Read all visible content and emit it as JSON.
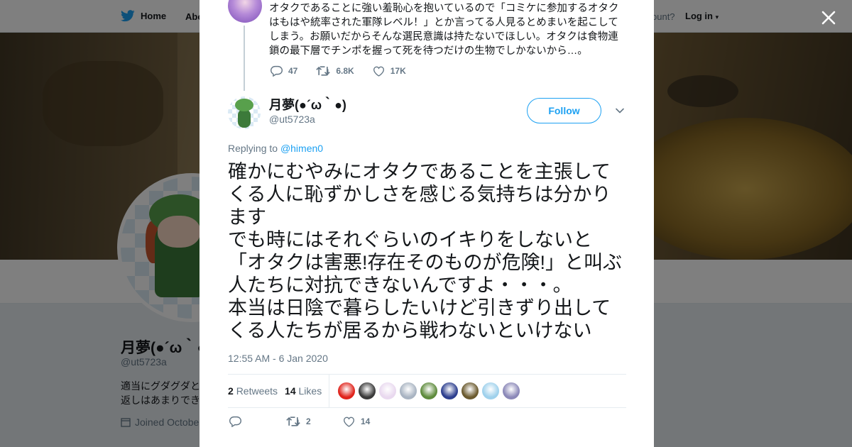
{
  "topnav": {
    "home_label": "Home",
    "about_label": "Abo",
    "account_prompt": "ccount?",
    "login_label": "Log in"
  },
  "profile": {
    "name": "月夢(●´ω｀●)",
    "handle": "@ut5723a",
    "bio_line1": "適当にグダグダと",
    "bio_line2": "返しはあまりでき",
    "joined": "Joined Octobe"
  },
  "parent_tweet": {
    "text": "オタクであることに強い羞恥心を抱いているので「コミケに参加するオタクはもはや統率された軍隊レベル！」とか言ってる人見るとめまいを起こしてしまう。お願いだからそんな選民意識は持たないでほしい。オタクは食物連鎖の最下層でチンポを握って死を待つだけの生物でしかないから…。",
    "replies": "47",
    "retweets": "6.8K",
    "likes": "17K"
  },
  "tweet": {
    "author_name": "月夢(●´ω｀●)",
    "author_handle": "@ut5723a",
    "follow_label": "Follow",
    "replying_prefix": "Replying to",
    "replying_to": "@himen0",
    "text": "確かにむやみにオタクであることを主張してくる人に恥ずかしさを感じる気持ちは分かります\nでも時にはそれぐらいのイキりをしないと「オタクは害悪!存在そのものが危険!」と叫ぶ人たちに対抗できないんですよ・・・。\n本当は日陰で暮らしたいけど引きずり出してくる人たちが居るから戦わないといけない",
    "timestamp": "12:55 AM - 6 Jan 2020",
    "retweet_count": "2",
    "retweet_label": "Retweets",
    "like_count": "14",
    "like_label": "Likes",
    "bottom_retweets": "2",
    "bottom_likes": "14"
  },
  "likers": [
    {
      "name": "liker-1",
      "color": "#e0241c"
    },
    {
      "name": "liker-2",
      "color": "#3a3a3a"
    },
    {
      "name": "liker-3",
      "color": "#e9d9ef"
    },
    {
      "name": "liker-4",
      "color": "#a9b4c2"
    },
    {
      "name": "liker-5",
      "color": "#5e8b3c"
    },
    {
      "name": "liker-6",
      "color": "#2d3f8f"
    },
    {
      "name": "liker-7",
      "color": "#6b5a2e"
    },
    {
      "name": "liker-8",
      "color": "#9fd1ec"
    },
    {
      "name": "liker-9",
      "color": "#8b88b8"
    }
  ],
  "colors": {
    "accent": "#1da1f2",
    "text": "#14171a",
    "muted": "#657786"
  }
}
